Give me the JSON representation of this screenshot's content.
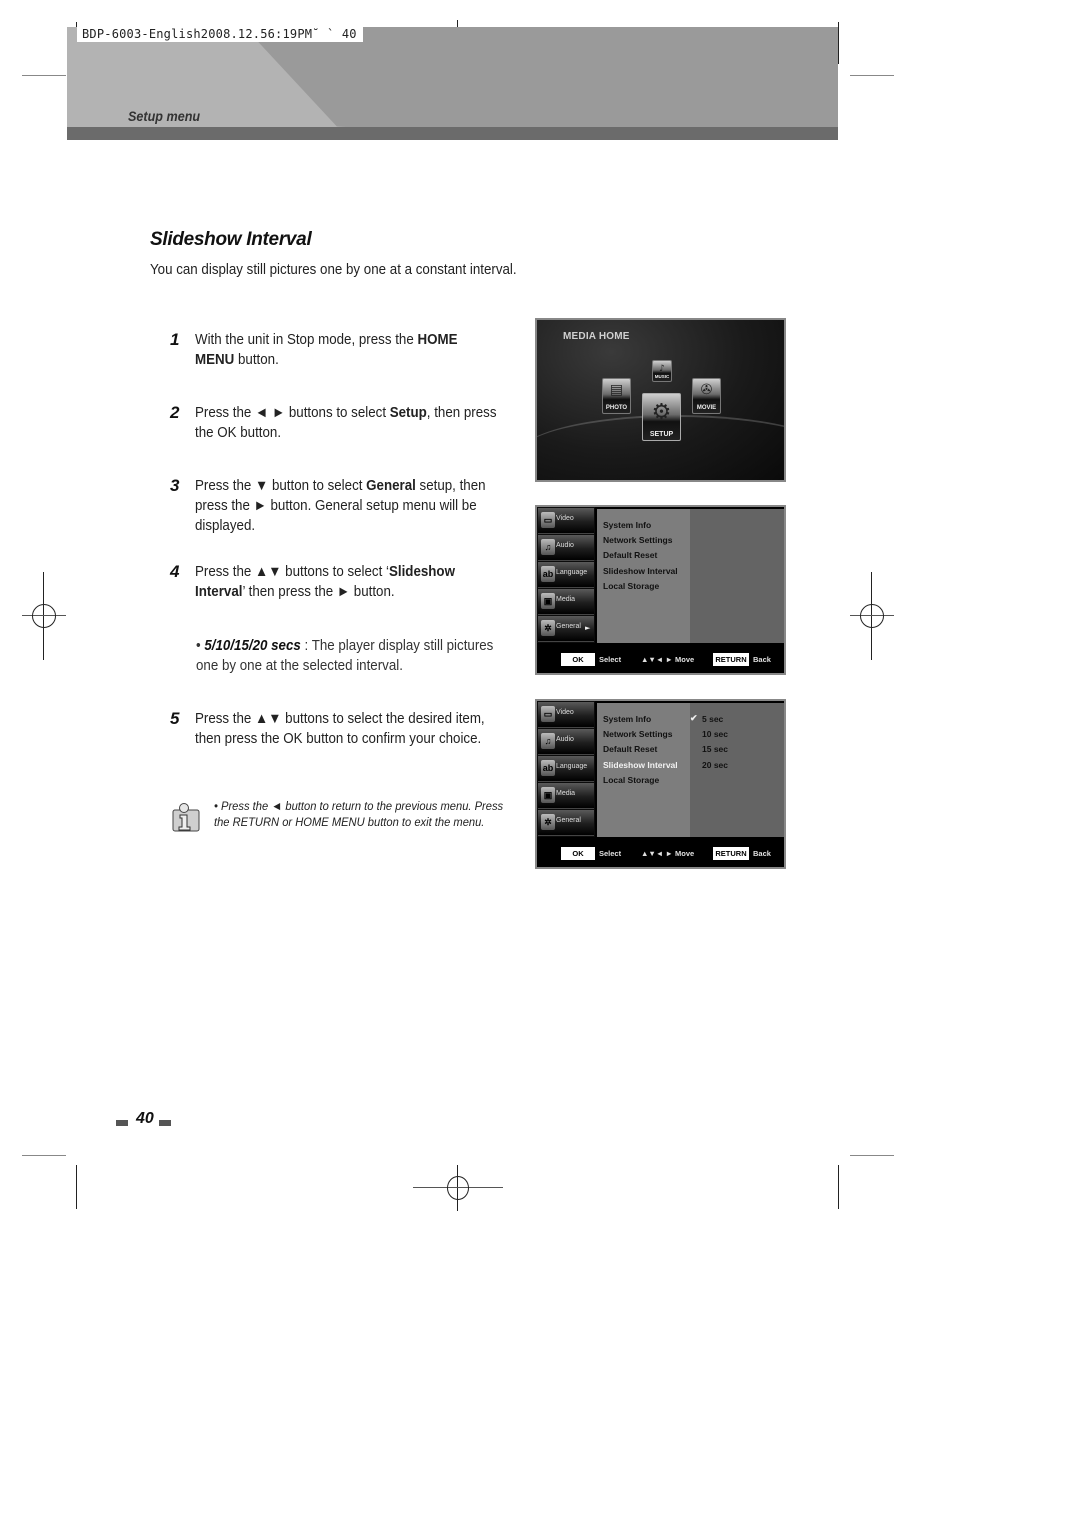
{
  "slug": "BDP-6003-English2008.12.56:19PM˘  ` 40",
  "header": {
    "section": "Setup menu"
  },
  "title": "Slideshow Interval",
  "intro": "You can display still pictures one by one at a constant interval.",
  "steps": [
    {
      "num": "1",
      "parts": [
        "With the unit in Stop mode, press the ",
        "HOME MENU",
        " button."
      ]
    },
    {
      "num": "2",
      "parts": [
        "Press the ◄ ► buttons to select ",
        "Setup",
        ", then press the OK button."
      ]
    },
    {
      "num": "3",
      "parts": [
        "Press the ▼ button to select ",
        "General",
        " setup, then press the ► button. General setup menu will be displayed."
      ]
    },
    {
      "num": "4",
      "parts": [
        "Press the ▲▼ buttons to select ‘",
        "Slideshow Interval",
        "’ then press the ► button."
      ]
    },
    {
      "num": "5",
      "parts": [
        "Press the ▲▼ buttons to select the desired item, then press the OK button to confirm your choice.",
        "",
        ""
      ]
    }
  ],
  "bullet": {
    "mark": "•",
    "emph": "5/10/15/20 secs",
    "text": " : The player display still pictures one by one at the selected interval."
  },
  "note": {
    "icon": "info-icon",
    "text": "• Press the ◄ button to return to the previous menu. Press the RETURN or HOME MENU button to exit the menu."
  },
  "media_home": {
    "title": "MEDIA HOME",
    "items": [
      {
        "label": "MUSIC",
        "icon": "music-icon"
      },
      {
        "label": "PHOTO",
        "icon": "photo-icon"
      },
      {
        "label": "MOVIE",
        "icon": "movie-icon"
      },
      {
        "label": "SETUP",
        "icon": "gear-icon",
        "selected": true
      }
    ]
  },
  "setup_menu": {
    "sidebar": [
      {
        "label": "Video",
        "icon": "tv-icon",
        "glyph": "▭"
      },
      {
        "label": "Audio",
        "icon": "speaker-icon",
        "glyph": "♫"
      },
      {
        "label": "Language",
        "icon": "language-icon",
        "glyph": "ab"
      },
      {
        "label": "Media",
        "icon": "media-icon",
        "glyph": "▣"
      },
      {
        "label": "General",
        "icon": "gear-icon",
        "glyph": "✲",
        "arrow": "►"
      }
    ],
    "items": [
      "System Info",
      "Network Settings",
      "Default Reset",
      "Slideshow Interval",
      "Local Storage"
    ],
    "selected_item": "Slideshow Interval",
    "options": [
      "5 sec",
      "10 sec",
      "15 sec",
      "20 sec"
    ],
    "checked_option": "5 sec",
    "check_mark": "✔",
    "footer": {
      "ok_key": "OK",
      "ok_label": "Select",
      "move_keys": "▲▼◄ ►",
      "move_label": "Move",
      "return_key": "RETURN",
      "return_label": "Back"
    }
  },
  "page_number": "40"
}
